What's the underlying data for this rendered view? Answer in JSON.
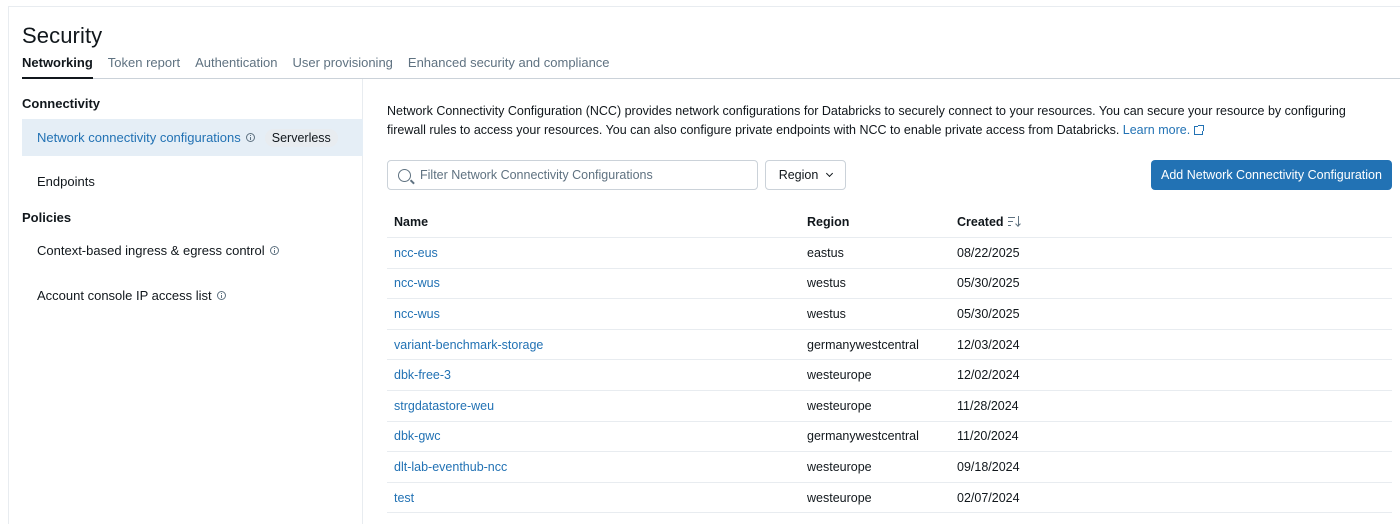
{
  "page": {
    "title": "Security"
  },
  "tabs": [
    {
      "label": "Networking",
      "active": true
    },
    {
      "label": "Token report"
    },
    {
      "label": "Authentication"
    },
    {
      "label": "User provisioning"
    },
    {
      "label": "Enhanced security and compliance"
    }
  ],
  "sidebar": {
    "section_connectivity": "Connectivity",
    "section_policies": "Policies",
    "items": [
      {
        "label": "Network connectivity configurations",
        "badge": "Serverless",
        "active": true,
        "icon": "info-icon"
      },
      {
        "label": "Endpoints"
      },
      {
        "label": "Context-based ingress & egress control",
        "icon": "info-icon"
      },
      {
        "label": "Account console IP access list",
        "icon": "info-icon"
      }
    ]
  },
  "main": {
    "description": "Network Connectivity Configuration (NCC) provides network configurations for Databricks to securely connect to your resources. You can secure your resource by configuring firewall rules to access your resources. You can also configure private endpoints with NCC to enable private access from Databricks.",
    "learn_more": "Learn more.",
    "search_placeholder": "Filter Network Connectivity Configurations",
    "region_filter": "Region",
    "add_button": "Add Network Connectivity Configuration"
  },
  "table": {
    "columns": [
      "Name",
      "Region",
      "Created"
    ],
    "rows": [
      {
        "name": "ncc-eus",
        "region": "eastus",
        "created": "08/22/2025"
      },
      {
        "name": "ncc-wus",
        "region": "westus",
        "created": "05/30/2025"
      },
      {
        "name": "ncc-wus",
        "region": "westus",
        "created": "05/30/2025"
      },
      {
        "name": "variant-benchmark-storage",
        "region": "germanywestcentral",
        "created": "12/03/2024"
      },
      {
        "name": "dbk-free-3",
        "region": "westeurope",
        "created": "12/02/2024"
      },
      {
        "name": "strgdatastore-weu",
        "region": "westeurope",
        "created": "11/28/2024"
      },
      {
        "name": "dbk-gwc",
        "region": "germanywestcentral",
        "created": "11/20/2024"
      },
      {
        "name": "dlt-lab-eventhub-ncc",
        "region": "westeurope",
        "created": "09/18/2024"
      },
      {
        "name": "test",
        "region": "westeurope",
        "created": "02/07/2024"
      }
    ]
  },
  "colors": {
    "accent": "#2272b4",
    "active_bg": "#e5eef6",
    "text": "#11171c",
    "muted": "#5f7281"
  }
}
